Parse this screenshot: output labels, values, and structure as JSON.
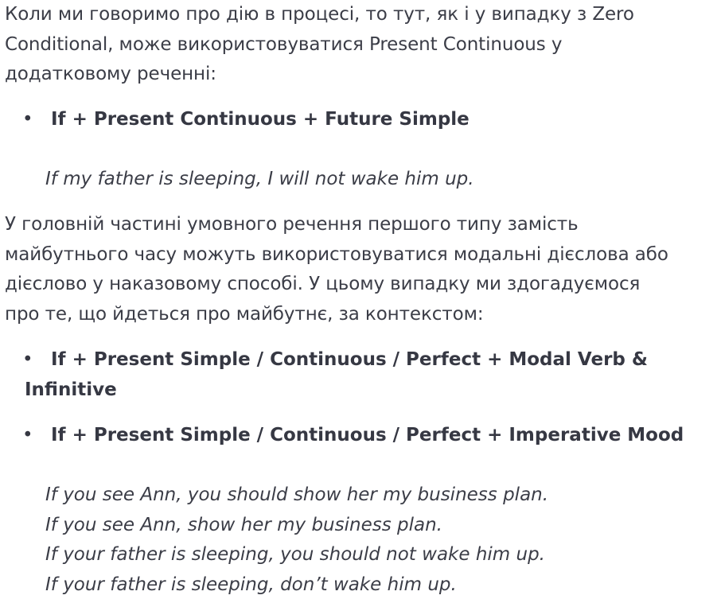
{
  "intro": {
    "line1": "Коли ми говоримо про дію в процесі, то тут, як і у випадку з Zero",
    "line2": "Conditional, може використовуватися Present Continuous у",
    "line3": "додатковому реченні:"
  },
  "formula1": {
    "bullet": "•",
    "text": "If + Present Continuous + Future Simple"
  },
  "example1": "If my father is sleeping, I will not wake him up.",
  "paragraph2": {
    "line1": "У головній частині умовного речення першого типу замість",
    "line2": "майбутнього часу можуть використовуватися модальні дієслова або",
    "line3": "дієслово у наказовому способі. У цьому випадку ми здогадуємося",
    "line4": "про те, що йдеться про майбутнє, за контекстом:"
  },
  "formula2": {
    "bullet": "•",
    "text_line1": "If + Present Simple / Continuous / Perfect + Modal Verb &",
    "text_line2": "Infinitive"
  },
  "formula3": {
    "bullet": "•",
    "text": "If + Present Simple / Continuous / Perfect + Imperative Mood"
  },
  "examples2": [
    "If you see Ann, you should show her my business plan.",
    "If you see Ann, show her my business plan.",
    "If your father is sleeping, you should not wake him up.",
    "If your father is sleeping, don’t wake him up."
  ]
}
